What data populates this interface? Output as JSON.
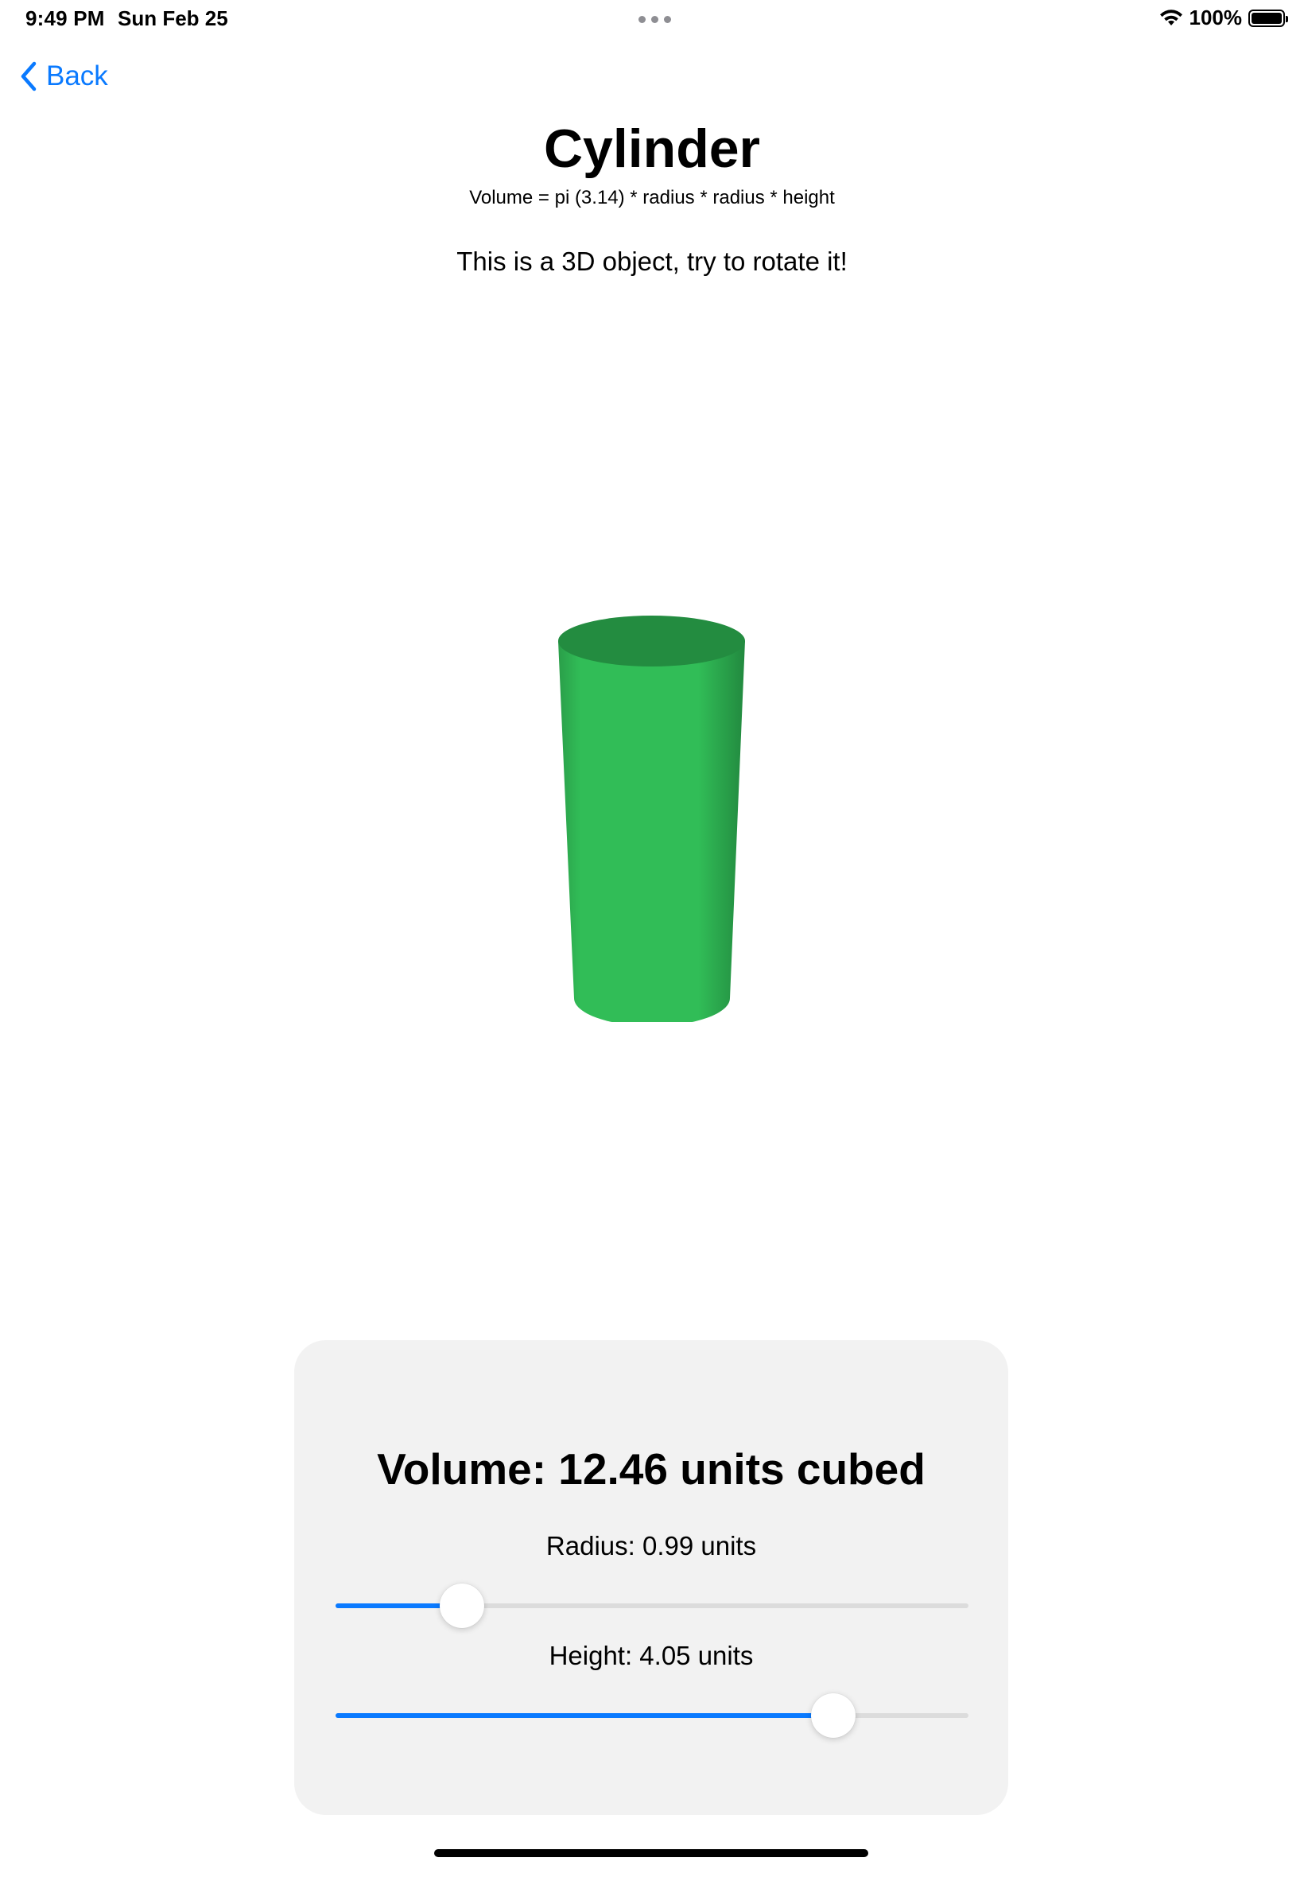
{
  "status_bar": {
    "time": "9:49 PM",
    "date": "Sun Feb 25",
    "battery_percent": "100%",
    "icons": [
      "wifi-icon",
      "battery-icon"
    ]
  },
  "nav": {
    "back_label": "Back"
  },
  "header": {
    "title": "Cylinder",
    "formula": "Volume = pi (3.14) * radius * radius * height",
    "instruction": "This is a 3D object, try to rotate it!"
  },
  "model": {
    "shape": "cylinder",
    "color": "#31bd57",
    "top_color": "#238c40"
  },
  "controls": {
    "volume_text": "Volume: 12.46 units cubed",
    "radius": {
      "label": "Radius: 0.99 units",
      "fraction": 0.2
    },
    "height": {
      "label": "Height: 4.05 units",
      "fraction": 0.787
    }
  },
  "colors": {
    "accent": "#0a7aff",
    "panel_background": "#f2f2f2",
    "track": "#dcdcdc"
  }
}
